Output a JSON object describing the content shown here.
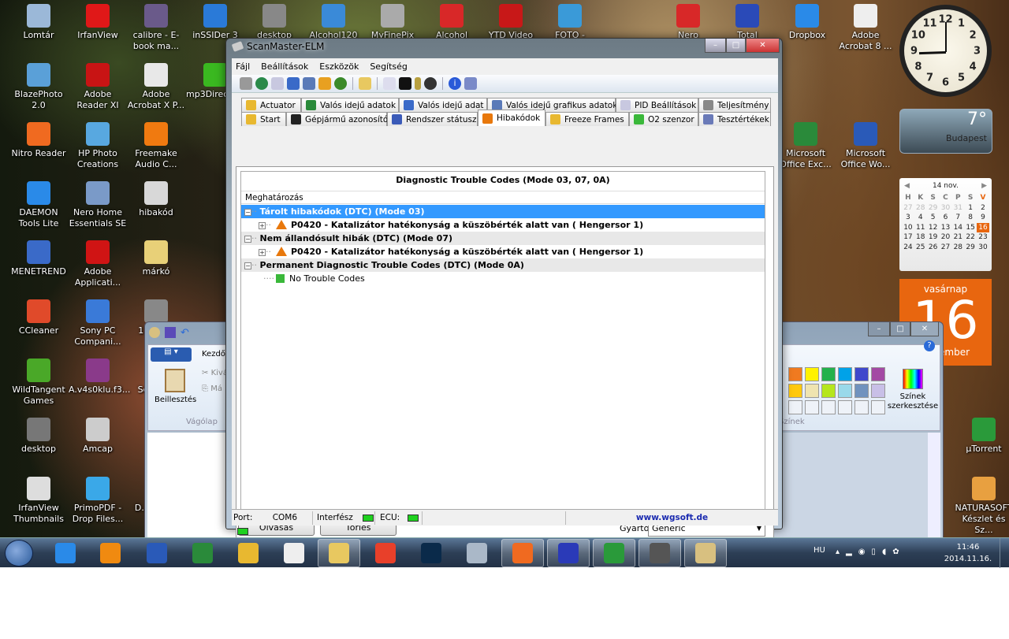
{
  "desktop_icons": [
    {
      "label": "Lomtár",
      "color": "#9bb8d8"
    },
    {
      "label": "IrfanView",
      "color": "#e01818"
    },
    {
      "label": "calibre - E-book ma...",
      "color": "#6a5a8a"
    },
    {
      "label": "inSSIDer 3",
      "color": "#2a7ad8"
    },
    {
      "label": "BlazePhoto 2.0",
      "color": "#5aa0d8"
    },
    {
      "label": "Adobe Reader XI",
      "color": "#c81414"
    },
    {
      "label": "Adobe Acrobat X P...",
      "color": "#e8e8e8"
    },
    {
      "label": "mp3DirectCut",
      "color": "#3ab820"
    },
    {
      "label": "Nitro Reader",
      "color": "#f06a20"
    },
    {
      "label": "HP Photo Creations",
      "color": "#58a8e0"
    },
    {
      "label": "Freemake Audio C...",
      "color": "#f07a10"
    },
    {
      "label": "DAEMON Tools Lite",
      "color": "#2a8ae8"
    },
    {
      "label": "Nero Home Essentials SE",
      "color": "#7a9ac8"
    },
    {
      "label": "hibakód",
      "color": "#d8d8d8"
    },
    {
      "label": "MENETREND",
      "color": "#3a6ac8"
    },
    {
      "label": "Adobe Applicati...",
      "color": "#d01414"
    },
    {
      "label": "márkó",
      "color": "#e8d078"
    },
    {
      "label": "CCleaner",
      "color": "#e04a2a"
    },
    {
      "label": "Sony PC Compani...",
      "color": "#3a7ad8"
    },
    {
      "label": "13998...",
      "color": "#888888"
    },
    {
      "label": "WildTangent Games",
      "color": "#4aa828"
    },
    {
      "label": "A.v4s0klu.f3...",
      "color": "#8a3a8a"
    },
    {
      "label": "ScanM...",
      "color": "#888888"
    },
    {
      "label": "desktop",
      "color": "#777777"
    },
    {
      "label": "Amcap",
      "color": "#cccccc"
    },
    {
      "label": "Wi...",
      "color": "#888888"
    },
    {
      "label": "IrfanView Thumbnails",
      "color": "#dddddd"
    },
    {
      "label": "PrimoPDF - Drop Files...",
      "color": "#3aa8e8"
    },
    {
      "label": "D... Dec...",
      "color": "#aaaaaa"
    },
    {
      "label": "desktop",
      "color": "#888888"
    },
    {
      "label": "Alcohol120",
      "color": "#3a8ad8"
    },
    {
      "label": "MyFinePix",
      "color": "#aaaaaa"
    },
    {
      "label": "Alcohol 120%",
      "color": "#d82828"
    },
    {
      "label": "YTD Video",
      "color": "#c81818"
    },
    {
      "label": "FOTO - Media",
      "color": "#3a9ad8"
    },
    {
      "label": "Nero",
      "color": "#d82828"
    },
    {
      "label": "Total",
      "color": "#2a4ab8"
    },
    {
      "label": "Dropbox",
      "color": "#2a8ae8"
    },
    {
      "label": "Adobe Acrobat 8 ...",
      "color": "#eeeeee"
    },
    {
      "label": "Microsoft Office Exc...",
      "color": "#2a8a3a"
    },
    {
      "label": "Microsoft Office Wo...",
      "color": "#2a5ab8"
    },
    {
      "label": "µTorrent",
      "color": "#2a9a3a"
    },
    {
      "label": "NATURASOFT Készlet és Sz...",
      "color": "#e8a040"
    }
  ],
  "gadgets": {
    "clock": {
      "time": "11:46",
      "numbers": [
        "12",
        "1",
        "2",
        "3",
        "4",
        "5",
        "6",
        "7",
        "8",
        "9",
        "10",
        "11"
      ]
    },
    "weather": {
      "temp": "7°",
      "city": "Budapest"
    },
    "calendar": {
      "month_label": "14 nov.",
      "weekdays": [
        "H",
        "K",
        "S",
        "C",
        "P",
        "S",
        "V"
      ],
      "weeks": [
        [
          "27",
          "28",
          "29",
          "30",
          "31",
          "1",
          "2"
        ],
        [
          "3",
          "4",
          "5",
          "6",
          "7",
          "8",
          "9"
        ],
        [
          "10",
          "11",
          "12",
          "13",
          "14",
          "15",
          "16"
        ],
        [
          "17",
          "18",
          "19",
          "20",
          "21",
          "22",
          "23"
        ],
        [
          "24",
          "25",
          "26",
          "27",
          "28",
          "29",
          "30"
        ]
      ],
      "today": "16",
      "day_name": "vasárnap",
      "month_name": "november"
    }
  },
  "paint": {
    "paste_label": "Beillesztés",
    "cut_label": "Kivá",
    "copy_label": "Má",
    "clipboard_group": "Vágólap",
    "home_tab": "Kezdő",
    "edit_colors": "Színek szerkesztése",
    "colors_group": "Színek",
    "colors_row1": [
      "#f07a20",
      "#fff200",
      "#22b14c",
      "#00a2e8",
      "#3f48cc",
      "#a349a4"
    ],
    "colors_row2": [
      "#ffc90e",
      "#efe4b0",
      "#b5e61d",
      "#99d9ea",
      "#7092be",
      "#c8bfe7"
    ]
  },
  "scanmaster": {
    "title": "ScanMaster-ELM",
    "menu": [
      "Fájl",
      "Beállítások",
      "Eszközök",
      "Segítség"
    ],
    "tabs_row1": [
      "Actuator",
      "Valós idejű adatok",
      "Valós idejű adat",
      "Valós idejű grafikus adatok",
      "PID Beállítások",
      "Teljesítmény"
    ],
    "tabs_row2": [
      "Start",
      "Gépjármű azonosító",
      "Rendszer státusz",
      "Hibakódok",
      "Freeze Frames",
      "O2 szenzor",
      "Tesztértékek"
    ],
    "active_tab": "Hibakódok",
    "panel_title": "Diagnostic Trouble Codes (Mode 03, 07, 0A)",
    "column_header": "Meghatározás",
    "tree": [
      {
        "label": "Tárolt hibakódok (DTC) (Mode 03)",
        "selected": true,
        "children": [
          "P0420 - Katalizátor hatékonyság a küszöbérték alatt van ( Hengersor 1)"
        ]
      },
      {
        "label": "Nem állandósult hibák (DTC) (Mode 07)",
        "children": [
          "P0420 - Katalizátor hatékonyság a küszöbérték alatt van ( Hengersor 1)"
        ]
      },
      {
        "label": "Permanent Diagnostic Trouble Codes (DTC) (Mode 0A)",
        "children": [
          "No Trouble Codes"
        ]
      }
    ],
    "read_button": "Olvasás",
    "clear_button": "Törlés",
    "manufacturer_label": "Gyártó",
    "manufacturer_value": "Generic",
    "status": {
      "port_label": "Port:",
      "port_value": "COM6",
      "interface_label": "Interfész",
      "ecu_label": "ECU:",
      "url": "www.wgsoft.de"
    },
    "selection_color": "#3399ff"
  },
  "taskbar": {
    "language": "HU",
    "time": "11:46",
    "date": "2014.11.16.",
    "apps": [
      {
        "name": "internet-explorer",
        "color": "#2a8ae8"
      },
      {
        "name": "media-player",
        "color": "#f08a10"
      },
      {
        "name": "word",
        "color": "#2a5ab8"
      },
      {
        "name": "excel",
        "color": "#2a8a3a"
      },
      {
        "name": "outlook",
        "color": "#e8b830"
      },
      {
        "name": "acrobat",
        "color": "#eeeeee"
      },
      {
        "name": "explorer",
        "color": "#e8c860"
      },
      {
        "name": "chrome",
        "color": "#e8402a"
      },
      {
        "name": "photoshop",
        "color": "#0a2a4a"
      },
      {
        "name": "calculator",
        "color": "#aab8c8"
      },
      {
        "name": "nitro",
        "color": "#f06a20"
      },
      {
        "name": "total-commander",
        "color": "#2a3ab8"
      },
      {
        "name": "utorrent",
        "color": "#2a9a3a"
      },
      {
        "name": "scanmaster",
        "color": "#555555"
      },
      {
        "name": "paint",
        "color": "#d8c080"
      }
    ]
  }
}
